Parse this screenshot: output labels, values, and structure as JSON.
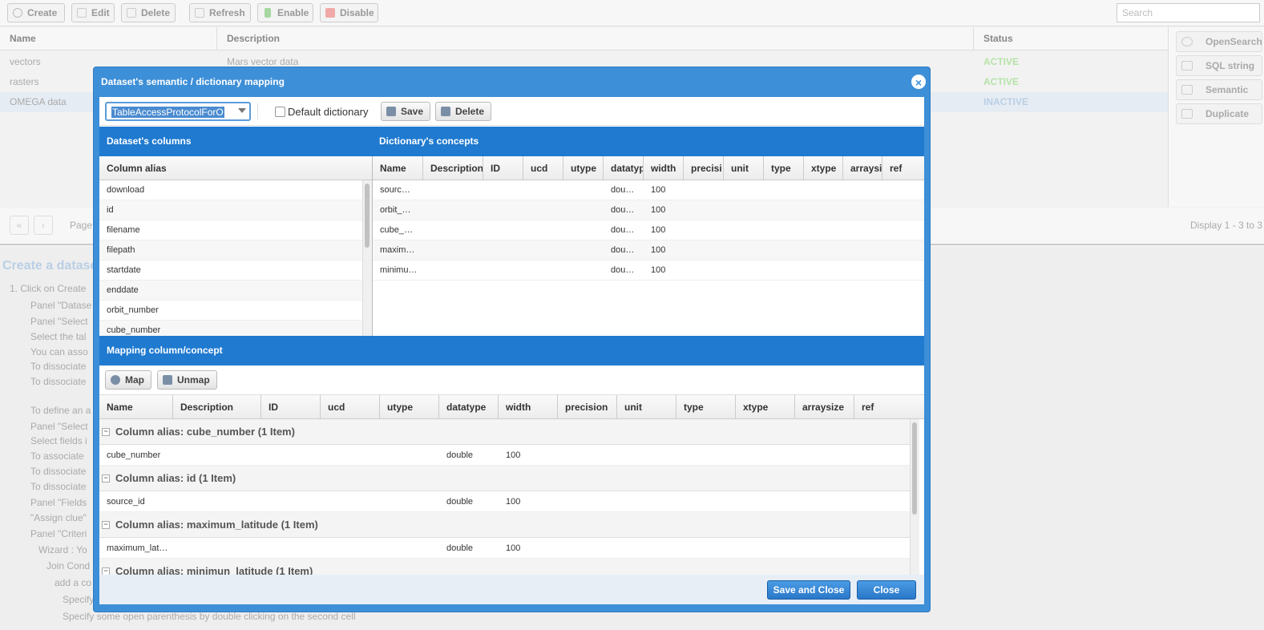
{
  "toolbar": {
    "create": "Create",
    "edit": "Edit",
    "delete": "Delete",
    "refresh": "Refresh",
    "enable": "Enable",
    "disable": "Disable",
    "search_placeholder": "Search"
  },
  "grid": {
    "headers": [
      "Name",
      "Description",
      "Status"
    ],
    "rows": [
      {
        "name": "vectors",
        "description": "Mars vector data",
        "status": "ACTIVE"
      },
      {
        "name": "rasters",
        "description": "",
        "status": "ACTIVE"
      },
      {
        "name": "OMEGA data",
        "description": "",
        "status": "INACTIVE"
      }
    ]
  },
  "sidebar": {
    "items": [
      "OpenSearch",
      "SQL string",
      "Semantic",
      "Duplicate"
    ]
  },
  "pager": {
    "page_label": "Page",
    "display": "Display 1 - 3 to 3"
  },
  "help": {
    "title": "Create a datase",
    "lines": [
      "1.  Click on Create",
      "Panel \"Datase",
      "Panel \"Select",
      "Select the tal",
      "You can asso",
      "To dissociate",
      "To dissociate",
      "To define an a",
      "Panel \"Select",
      "Select fields i",
      "To associate",
      "To dissociate",
      "To dissociate",
      "Panel \"Fields",
      "\"Assign clue\"",
      "Panel \"Criteri",
      "Wizard :  Yo",
      "Join Cond",
      "add a co",
      "Specify",
      "Specify some open parenthesis by double clicking on the second cell"
    ]
  },
  "dialog": {
    "title": "Dataset's semantic / dictionary mapping",
    "combo_value": "TableAccessProtocolForO",
    "default_dictionary": "Default dictionary",
    "save": "Save",
    "delete": "Delete",
    "columns_title": "Dataset's columns",
    "concepts_title": "Dictionary's concepts",
    "column_alias_header": "Column alias",
    "columns": [
      "download",
      "id",
      "filename",
      "filepath",
      "startdate",
      "enddate",
      "orbit_number",
      "cube_number"
    ],
    "concept_headers": [
      "Name",
      "Description",
      "ID",
      "ucd",
      "utype",
      "datatyp",
      "width",
      "precisi",
      "unit",
      "type",
      "xtype",
      "arraysi",
      "ref"
    ],
    "concepts": [
      {
        "name": "sourc…",
        "datatype": "dou…",
        "width": "100"
      },
      {
        "name": "orbit_…",
        "datatype": "dou…",
        "width": "100"
      },
      {
        "name": "cube_…",
        "datatype": "dou…",
        "width": "100"
      },
      {
        "name": "maxim…",
        "datatype": "dou…",
        "width": "100"
      },
      {
        "name": "minimu…",
        "datatype": "dou…",
        "width": "100"
      }
    ],
    "mapping_title": "Mapping column/concept",
    "map": "Map",
    "unmap": "Unmap",
    "mapping_headers": [
      "Name",
      "Description",
      "ID",
      "ucd",
      "utype",
      "datatype",
      "width",
      "precision",
      "unit",
      "type",
      "xtype",
      "arraysize",
      "ref"
    ],
    "groups": [
      {
        "label": "Column alias: cube_number (1 Item)",
        "name": "cube_number",
        "datatype": "double",
        "width": "100"
      },
      {
        "label": "Column alias: id (1 Item)",
        "name": "source_id",
        "datatype": "double",
        "width": "100"
      },
      {
        "label": "Column alias: maximum_latitude (1 Item)",
        "name": "maximum_lat…",
        "datatype": "double",
        "width": "100"
      },
      {
        "label": "Column alias: minimun_latitude (1 Item)"
      }
    ],
    "save_and_close": "Save and Close",
    "close": "Close"
  }
}
